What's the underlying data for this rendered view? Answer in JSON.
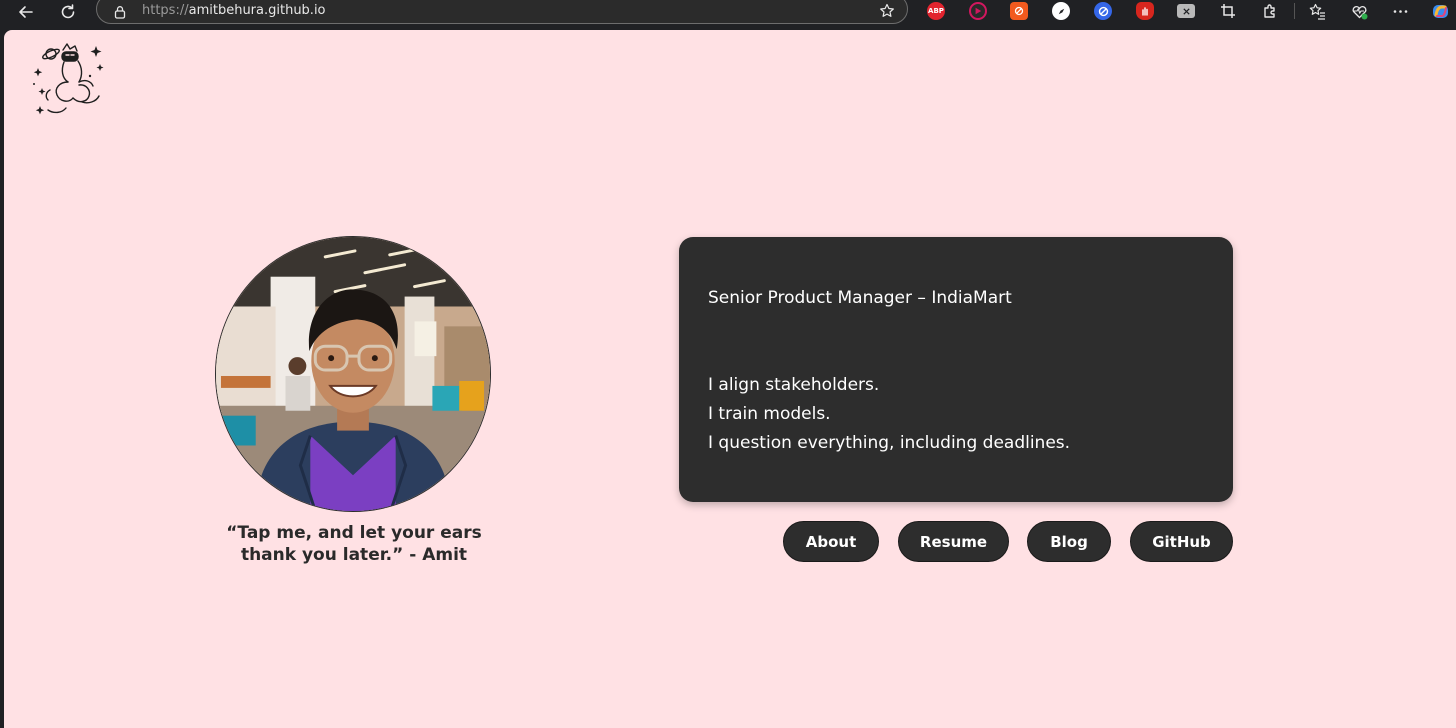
{
  "browser": {
    "url_scheme": "https://",
    "url_host": "amitbehura.github.io",
    "extensions": [
      {
        "name": "adblock-plus-extension-icon",
        "label": "ABP",
        "color": "#e2242f"
      }
    ]
  },
  "hero": {
    "quote_line1": "“Tap me, and let your ears",
    "quote_line2": "thank you later.” - Amit"
  },
  "card": {
    "title": "Senior Product Manager – IndiaMart",
    "lines": [
      "I align stakeholders.",
      "I train models.",
      "I question everything, including deadlines."
    ]
  },
  "nav": {
    "about": "About",
    "resume": "Resume",
    "blog": "Blog",
    "github": "GitHub"
  },
  "colors": {
    "page_bg": "#ffe1e4",
    "card_bg": "#2d2d2d",
    "button_bg": "#2d2d2d",
    "text_dark": "#2a2a2a"
  }
}
